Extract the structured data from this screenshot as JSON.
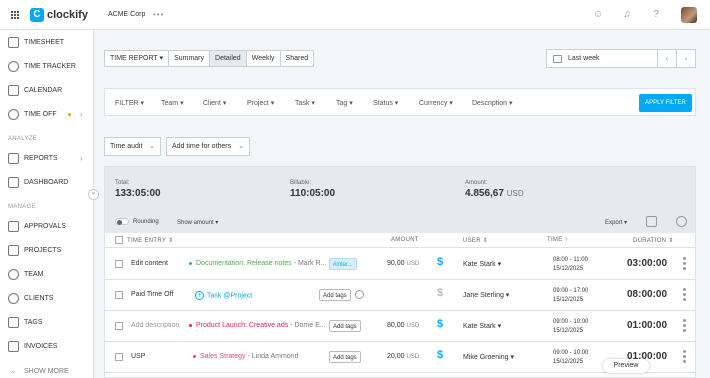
{
  "app": {
    "name": "clockify",
    "workspace": "ACME Corp",
    "workspace_menu": "•••"
  },
  "sidebar": {
    "items": [
      {
        "label": "TIMESHEET"
      },
      {
        "label": "TIME TRACKER"
      },
      {
        "label": "CALENDAR"
      },
      {
        "label": "TIME OFF"
      }
    ],
    "analyze_heading": "ANALYZE",
    "analyze_items": [
      {
        "label": "REPORTS"
      },
      {
        "label": "DASHBOARD"
      }
    ],
    "manage_heading": "MANAGE",
    "manage_items": [
      {
        "label": "APPROVALS"
      },
      {
        "label": "PROJECTS"
      },
      {
        "label": "TEAM"
      },
      {
        "label": "CLIENTS"
      },
      {
        "label": "TAGS"
      },
      {
        "label": "INVOICES"
      }
    ],
    "show_more": "SHOW MORE",
    "collapse_glyph": "«"
  },
  "report_tabs": {
    "type_select": "TIME REPORT",
    "tabs": [
      "Summary",
      "Detailed",
      "Weekly",
      "Shared"
    ],
    "active": "Detailed"
  },
  "date_range": {
    "label": "Last week",
    "prev": "‹",
    "next": "›"
  },
  "filters": {
    "items": [
      "FILTER",
      "Team",
      "Client",
      "Project",
      "Task",
      "Tag",
      "Status",
      "Currency",
      "Description"
    ],
    "apply_label": "APPLY FILTER"
  },
  "actions": {
    "audit_label": "Time audit",
    "add_time_label": "Add time for others"
  },
  "summary": {
    "total_label": "Total:",
    "total_value": "133:05:00",
    "billable_label": "Billable:",
    "billable_value": "110:05:00",
    "amount_label": "Amount:",
    "amount_value": "4.856,67",
    "amount_currency": "USD"
  },
  "controls": {
    "rounding_label": "Rounding",
    "show_amount_label": "Show amount",
    "export_label": "Export"
  },
  "table": {
    "headers": {
      "entry": "TIME ENTRY",
      "amount": "AMOUNT",
      "user": "USER",
      "time": "TIME",
      "duration": "DURATION"
    },
    "rows": [
      {
        "description": "Edit content",
        "project": "Documentation: Release notes",
        "client": "- Mark R...",
        "project_color": "#4caf50",
        "tag": "#inter...",
        "amount": "90,00",
        "currency": "USD",
        "billable": true,
        "user": "Kate Stark",
        "start": "08:00",
        "end": "11:00",
        "date": "15/12/2025",
        "duration": "03:00:00"
      },
      {
        "description": "Paid Time Off",
        "project": "Task @Project",
        "client": "",
        "project_color": "#03a9f4",
        "tag": "Add tags",
        "amount": "",
        "currency": "",
        "billable": false,
        "user": "Jane Sterling",
        "start": "09:00",
        "end": "17:00",
        "date": "15/12/2025",
        "duration": "08:00:00"
      },
      {
        "description": "Add description",
        "project": "Product Launch: Creative ads",
        "client": "- Dome E...",
        "project_color": "#e91e63",
        "tag": "Add tags",
        "amount": "80,00",
        "currency": "USD",
        "billable": true,
        "user": "Kate Stark",
        "start": "09:00",
        "end": "10:00",
        "date": "15/12/2025",
        "duration": "01:00:00"
      },
      {
        "description": "USP",
        "project": "Sales Strategy",
        "client": "- Linda Ammond",
        "project_color": "#ff4081",
        "tag": "Add tags",
        "amount": "20,00",
        "currency": "USD",
        "billable": true,
        "user": "Mike Groening",
        "start": "09:00",
        "end": "10:00",
        "date": "15/12/2025",
        "duration": "01:00:00"
      }
    ]
  },
  "preview_label": "Preview",
  "colors": {
    "accent": "#03a9f4",
    "summary_bg": "#e4eaee"
  }
}
